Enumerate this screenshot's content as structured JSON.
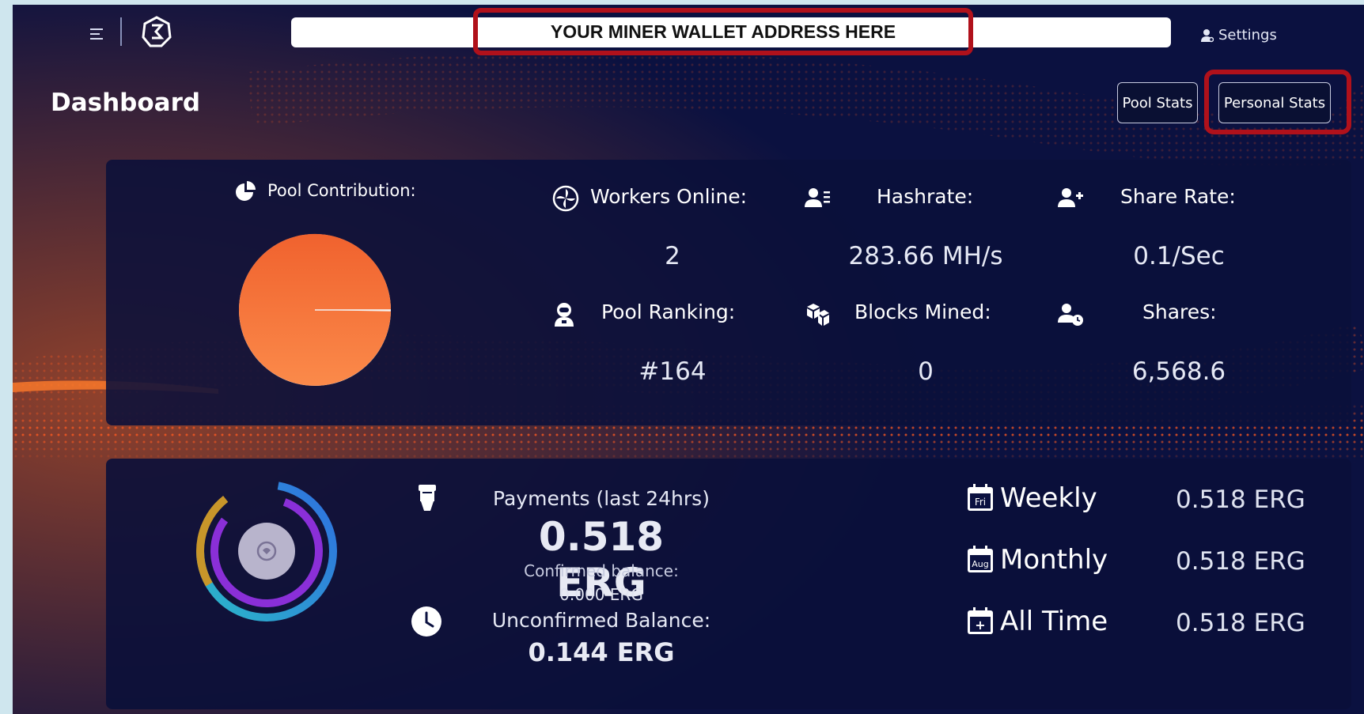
{
  "header": {
    "wallet_address": "YOUR MINER WALLET ADDRESS HERE",
    "settings_label": "Settings"
  },
  "page": {
    "title": "Dashboard",
    "tabs": [
      {
        "label": "Pool Stats"
      },
      {
        "label": "Personal Stats"
      }
    ]
  },
  "stats": {
    "contribution_label": "Pool Contribution:",
    "contribution_fraction": 0.997,
    "workers_label": "Workers Online:",
    "workers_value": "2",
    "hashrate_label": "Hashrate:",
    "hashrate_value": "283.66 MH/s",
    "share_rate_label": "Share Rate:",
    "share_rate_value": "0.1/Sec",
    "ranking_label": "Pool Ranking:",
    "ranking_value": "#164",
    "blocks_label": "Blocks Mined:",
    "blocks_value": "0",
    "shares_label": "Shares:",
    "shares_value": "6,568.6"
  },
  "payments": {
    "label": "Payments (last 24hrs)",
    "value": "0.518 ERG",
    "confirmed_label": "Confirmed balance:",
    "confirmed_value": "0.000 ERG",
    "unconfirmed_label": "Unconfirmed Balance:",
    "unconfirmed_value": "0.144 ERG"
  },
  "periods": [
    {
      "label": "Weekly",
      "value": "0.518 ERG",
      "icon": "calendar-fri-icon",
      "badge": "Fri"
    },
    {
      "label": "Monthly",
      "value": "0.518 ERG",
      "icon": "calendar-aug-icon",
      "badge": "Aug"
    },
    {
      "label": "All Time",
      "value": "0.518 ERG",
      "icon": "calendar-plus-icon",
      "badge": "+"
    }
  ],
  "colors": {
    "background": "#0b1140",
    "accent_orange": "#f47a3c",
    "highlight_red": "#b0111b"
  }
}
